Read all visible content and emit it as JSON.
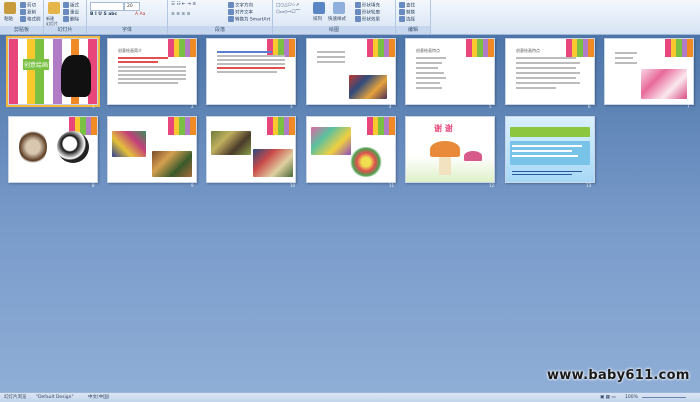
{
  "ribbon": {
    "groups": [
      {
        "label": "剪贴板"
      },
      {
        "label": "幻灯片"
      },
      {
        "label": "字体"
      },
      {
        "label": "段落"
      },
      {
        "label": "绘图"
      },
      {
        "label": "编辑"
      }
    ],
    "clipboard": {
      "paste": "粘贴",
      "cut": "剪切",
      "copy": "复制",
      "format_painter": "格式刷"
    },
    "slides": {
      "new_slide": "新建\n幻灯片",
      "layout": "版式",
      "reset": "重设",
      "delete": "删除"
    },
    "font": {
      "font_name": "",
      "font_size": "20"
    },
    "paragraph": {
      "text_direction": "文字方向",
      "align_text": "对齐文本",
      "smartart": "转换为 SmartArt"
    },
    "drawing": {
      "arrange": "排列",
      "quick_styles": "快速样式",
      "shape_fill": "形状填充",
      "shape_outline": "形状轮廓",
      "shape_effects": "形状效果"
    },
    "editing": {
      "find": "查找",
      "replace": "替换",
      "select": "选择"
    }
  },
  "slides": [
    {
      "num": "1",
      "title": "创意绘画"
    },
    {
      "num": "2",
      "title": "创意绘画简介"
    },
    {
      "num": "3",
      "title": ""
    },
    {
      "num": "4",
      "title": ""
    },
    {
      "num": "5",
      "title": "创意绘画特点"
    },
    {
      "num": "6",
      "title": "创意绘画特点"
    },
    {
      "num": "7",
      "title": ""
    },
    {
      "num": "8",
      "title": ""
    },
    {
      "num": "9",
      "title": ""
    },
    {
      "num": "10",
      "title": ""
    },
    {
      "num": "11",
      "title": ""
    },
    {
      "num": "12",
      "title": "谢 谢"
    },
    {
      "num": "13",
      "title": ""
    }
  ],
  "statusbar": {
    "view": "幻灯片浏览",
    "theme": "\"Default Design\"",
    "language": "中文(中国)",
    "zoom": "100%"
  },
  "watermark": "www.baby611.com"
}
